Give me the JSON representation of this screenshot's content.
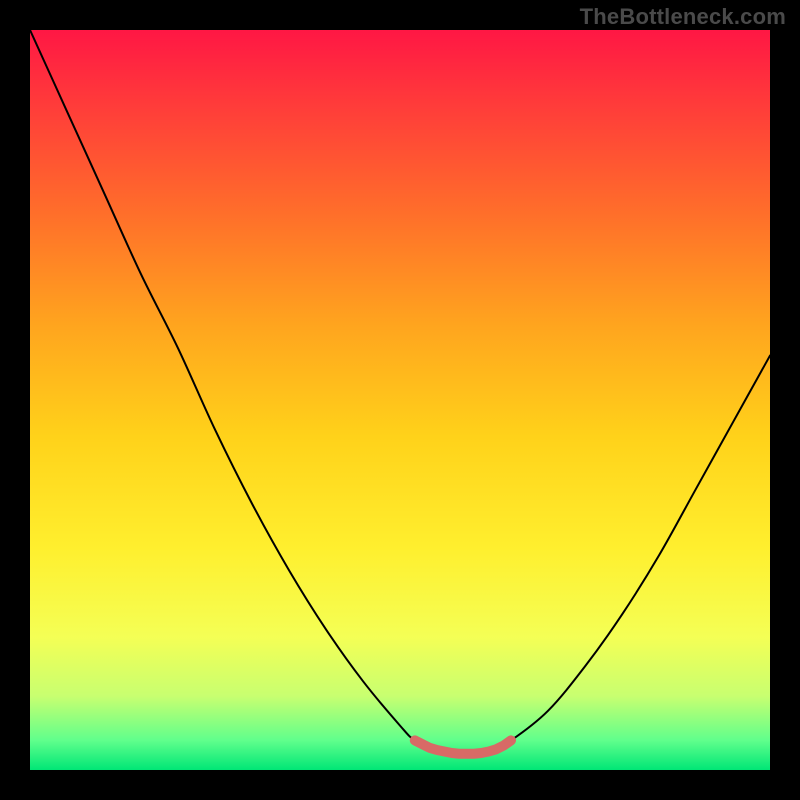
{
  "watermark": "TheBottleneck.com",
  "chart_data": {
    "type": "line",
    "title": "",
    "xlabel": "",
    "ylabel": "",
    "xlim": [
      0,
      100
    ],
    "ylim": [
      0,
      100
    ],
    "grid": false,
    "series": [
      {
        "name": "bottleneck-curve",
        "x": [
          0,
          5,
          10,
          15,
          20,
          25,
          30,
          35,
          40,
          45,
          50,
          52,
          55,
          58,
          60,
          62,
          65,
          70,
          75,
          80,
          85,
          90,
          95,
          100
        ],
        "values": [
          100,
          89,
          78,
          67,
          57,
          46,
          36,
          27,
          19,
          12,
          6,
          4,
          2.5,
          2,
          2,
          2.5,
          4,
          8,
          14,
          21,
          29,
          38,
          47,
          56
        ]
      },
      {
        "name": "optimal-marker",
        "x": [
          52,
          53,
          54,
          55,
          56,
          57,
          58,
          59,
          60,
          61,
          62,
          63,
          64,
          65
        ],
        "values": [
          4,
          3.5,
          3,
          2.7,
          2.5,
          2.3,
          2.2,
          2.2,
          2.2,
          2.3,
          2.5,
          2.8,
          3.3,
          4
        ]
      }
    ],
    "background_gradient_stops": [
      {
        "offset": 0.0,
        "color": "#ff1744"
      },
      {
        "offset": 0.1,
        "color": "#ff3b3a"
      },
      {
        "offset": 0.25,
        "color": "#ff6f2a"
      },
      {
        "offset": 0.4,
        "color": "#ffa51e"
      },
      {
        "offset": 0.55,
        "color": "#ffd21a"
      },
      {
        "offset": 0.7,
        "color": "#ffef2e"
      },
      {
        "offset": 0.82,
        "color": "#f4ff55"
      },
      {
        "offset": 0.9,
        "color": "#c8ff70"
      },
      {
        "offset": 0.96,
        "color": "#60ff8c"
      },
      {
        "offset": 1.0,
        "color": "#00e676"
      }
    ],
    "curve_stroke": "#000000",
    "marker_stroke": "#d86a66"
  }
}
